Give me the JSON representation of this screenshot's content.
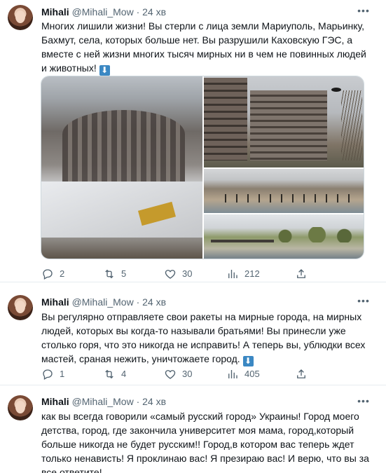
{
  "colors": {
    "text": "#0f1419",
    "secondary": "#536471",
    "divider": "#e6ecf0",
    "emoji_blue": "#3b88c3"
  },
  "tweets": [
    {
      "author": "Mihali",
      "handle": "@Mihali_Mow",
      "dot": "·",
      "time": "24 хв",
      "text": "Многих лишили жизни! Вы стерли с лица земли Мариуполь, Марьинку, Бахмут, села, которых больше нет. Вы разрушили Каховскую ГЭС, а вместе с ней жизни многих тысяч мирных ни в чем не повинных людей и животных!",
      "emoji": "⬇",
      "emoji_name": "down-arrow-emoji",
      "has_media": true,
      "stats": {
        "replies": "2",
        "retweets": "5",
        "likes": "30",
        "views": "212"
      }
    },
    {
      "author": "Mihali",
      "handle": "@Mihali_Mow",
      "dot": "·",
      "time": "24 хв",
      "text": "Вы регулярно отправляете свои ракеты на мирные города, на мирных людей, которых вы когда-то называли братьями! Вы принесли уже столько горя, что это никогда не исправить! А теперь вы, ублюдки всех мастей, сраная нежить, уничтожаете город.",
      "emoji": "⬇",
      "emoji_name": "down-arrow-emoji",
      "has_media": false,
      "stats": {
        "replies": "1",
        "retweets": "4",
        "likes": "30",
        "views": "405"
      }
    },
    {
      "author": "Mihali",
      "handle": "@Mihali_Mow",
      "dot": "·",
      "time": "24 хв",
      "text": "как вы всегда говорили «самый русский город» Украины! Город моего детства, город, где закончила университет моя мама, город,который больше никогда не будет русским!! Город,в котором вас теперь ждет только ненависть! Я проклинаю вас! Я презираю вас! И верю, что вы за все ответите!",
      "emoji": "",
      "has_media": false
    }
  ],
  "icons": {
    "more": "more-options-icon",
    "reply": "reply-icon",
    "retweet": "retweet-icon",
    "like": "heart-icon",
    "views": "views-icon",
    "share": "share-icon"
  }
}
